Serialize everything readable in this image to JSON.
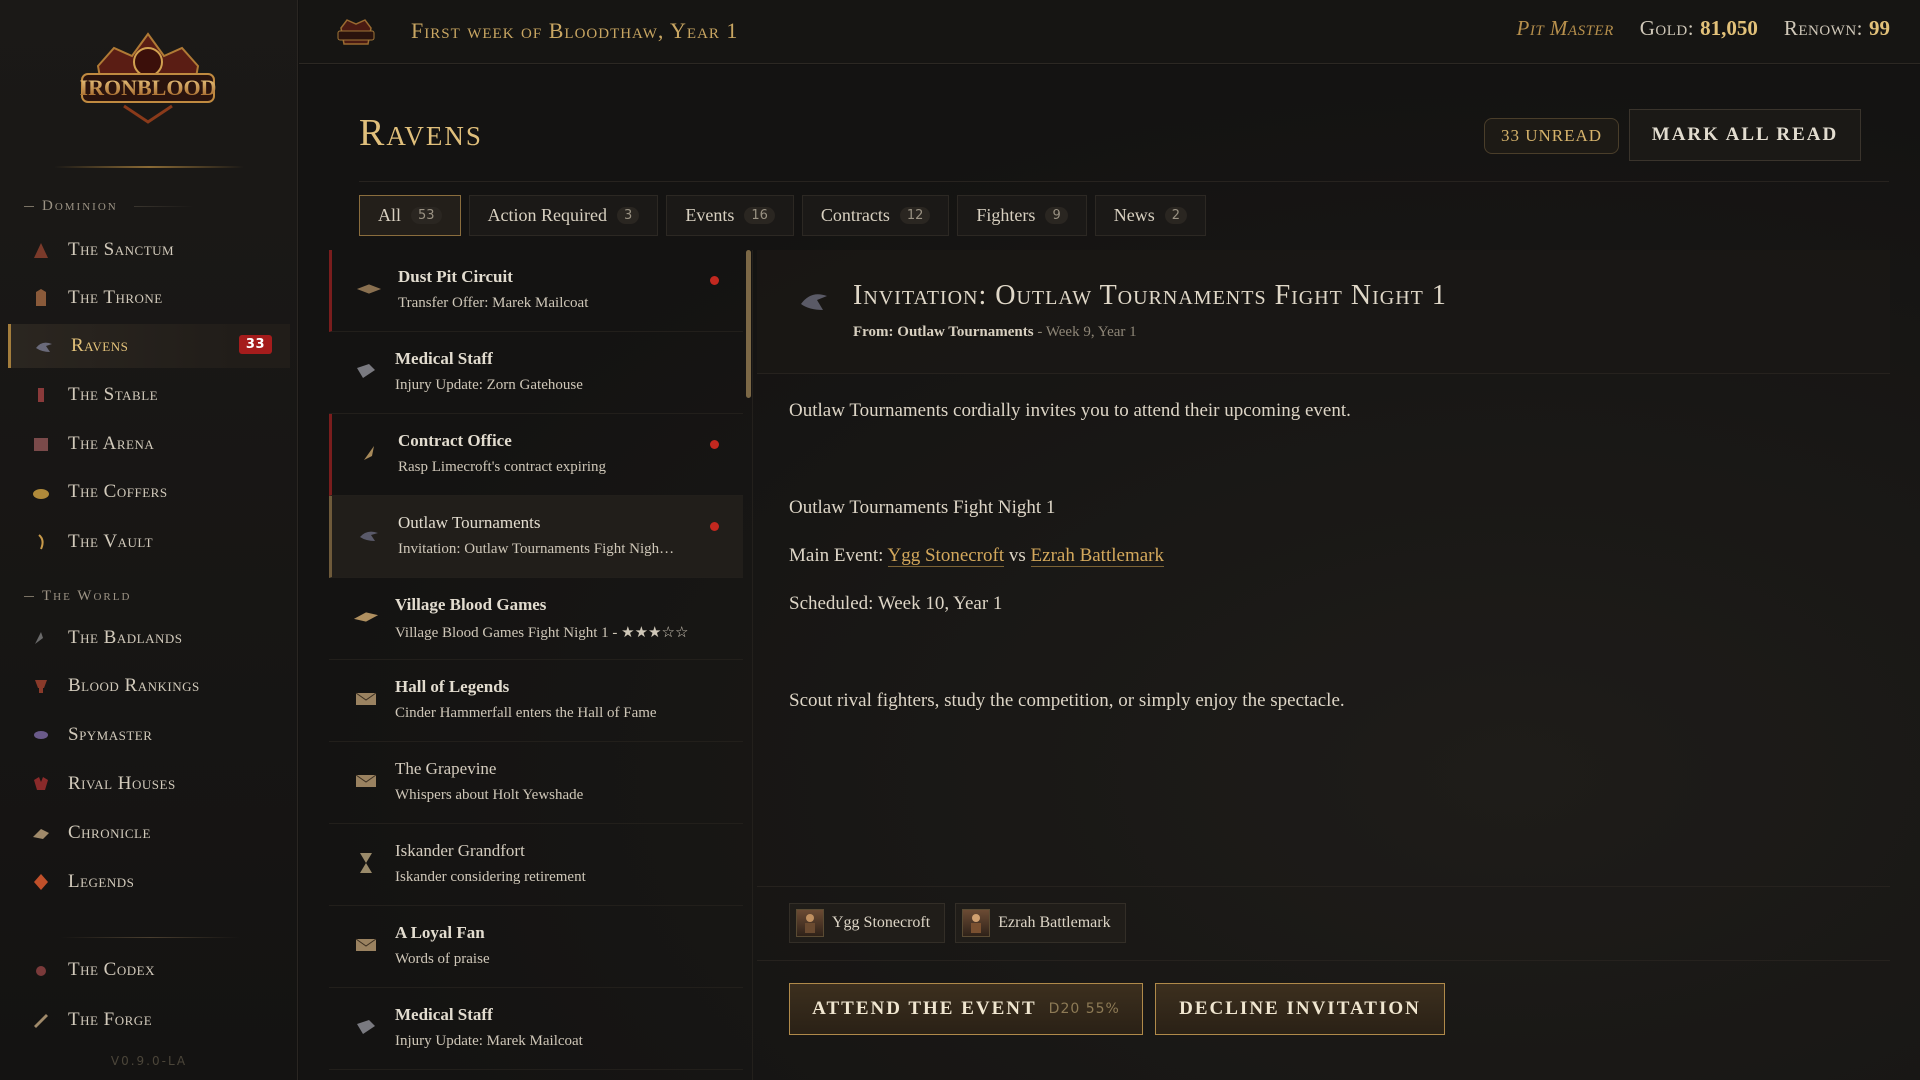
{
  "app": {
    "name": "IRONBLOOD",
    "version": "V0.9.0-LA"
  },
  "topbar": {
    "date": "First week of Bloodthaw, Year 1",
    "role": "Pit Master",
    "gold_label": "Gold:",
    "gold_value": "81,050",
    "renown_label": "Renown:",
    "renown_value": "99"
  },
  "sidebar": {
    "section_dominion": "Dominion",
    "section_world": "The World",
    "items": [
      {
        "label": "The Sanctum",
        "icon": "sanctum-icon"
      },
      {
        "label": "The Throne",
        "icon": "throne-icon"
      },
      {
        "label": "Ravens",
        "icon": "raven-icon",
        "badge": "33"
      },
      {
        "label": "The Stable",
        "icon": "stable-icon"
      },
      {
        "label": "The Arena",
        "icon": "arena-icon"
      },
      {
        "label": "The Coffers",
        "icon": "coffers-icon"
      },
      {
        "label": "The Vault",
        "icon": "vault-icon"
      },
      {
        "label": "The Badlands",
        "icon": "badlands-icon"
      },
      {
        "label": "Blood Rankings",
        "icon": "rankings-icon"
      },
      {
        "label": "Spymaster",
        "icon": "spymaster-icon"
      },
      {
        "label": "Rival Houses",
        "icon": "rival-houses-icon"
      },
      {
        "label": "Chronicle",
        "icon": "chronicle-icon"
      },
      {
        "label": "Legends",
        "icon": "legends-icon"
      },
      {
        "label": "The Codex",
        "icon": "codex-icon"
      },
      {
        "label": "The Forge",
        "icon": "forge-icon"
      }
    ]
  },
  "page": {
    "title": "Ravens",
    "unread": "33 UNREAD",
    "mark_all_read": "MARK ALL READ"
  },
  "tabs": [
    {
      "label": "All",
      "count": "53"
    },
    {
      "label": "Action Required",
      "count": "3"
    },
    {
      "label": "Events",
      "count": "16"
    },
    {
      "label": "Contracts",
      "count": "12"
    },
    {
      "label": "Fighters",
      "count": "9"
    },
    {
      "label": "News",
      "count": "2"
    }
  ],
  "messages": [
    {
      "sender": "Dust Pit Circuit",
      "subject": "Transfer Offer: Marek Mailcoat",
      "icon": "horn-icon",
      "unread": true
    },
    {
      "sender": "Medical Staff",
      "subject": "Injury Update: Zorn Gatehouse",
      "icon": "scroll-icon",
      "unread": false
    },
    {
      "sender": "Contract Office",
      "subject": "Rasp Limecroft's contract expiring",
      "icon": "quill-icon",
      "unread": true
    },
    {
      "sender": "Outlaw Tournaments",
      "subject": "Invitation: Outlaw Tournaments Fight Nigh…",
      "icon": "raven-icon",
      "unread": true
    },
    {
      "sender": "Village Blood Games",
      "subject": "Village Blood Games Fight Night 1 - ★★★☆☆",
      "icon": "banner-icon",
      "unread": false
    },
    {
      "sender": "Hall of Legends",
      "subject": "Cinder Hammerfall enters the Hall of Fame",
      "icon": "letter-icon",
      "unread": false
    },
    {
      "sender": "The Grapevine",
      "subject": "Whispers about Holt Yewshade",
      "icon": "letter-icon",
      "unread": false
    },
    {
      "sender": "Iskander Grandfort",
      "subject": "Iskander considering retirement",
      "icon": "hourglass-icon",
      "unread": false
    },
    {
      "sender": "A Loyal Fan",
      "subject": "Words of praise",
      "icon": "letter-icon",
      "unread": false
    },
    {
      "sender": "Medical Staff",
      "subject": "Injury Update: Marek Mailcoat",
      "icon": "scroll-icon",
      "unread": false
    }
  ],
  "detail": {
    "title": "Invitation: Outlaw Tournaments Fight Night 1",
    "from_label": "From:",
    "from_name": "Outlaw Tournaments",
    "from_meta": "- Week 9, Year 1",
    "intro": "Outlaw Tournaments cordially invites you to attend their upcoming event.",
    "event_name": "Outlaw Tournaments Fight Night 1",
    "main_event_label": "Main Event:",
    "fighter_a": "Ygg Stonecroft",
    "versus": "vs",
    "fighter_b": "Ezrah Battlemark",
    "scheduled": "Scheduled: Week 10, Year 1",
    "outro": "Scout rival fighters, study the competition, or simply enjoy the spectacle.",
    "chips": [
      "Ygg Stonecroft",
      "Ezrah Battlemark"
    ],
    "attend_label": "ATTEND THE EVENT",
    "attend_roll": "D20 55%",
    "decline_label": "DECLINE INVITATION"
  },
  "colors": {
    "accent_gold": "#e0bf7b",
    "badge_red": "#a51c1c",
    "unread_dot": "#c2281f"
  }
}
